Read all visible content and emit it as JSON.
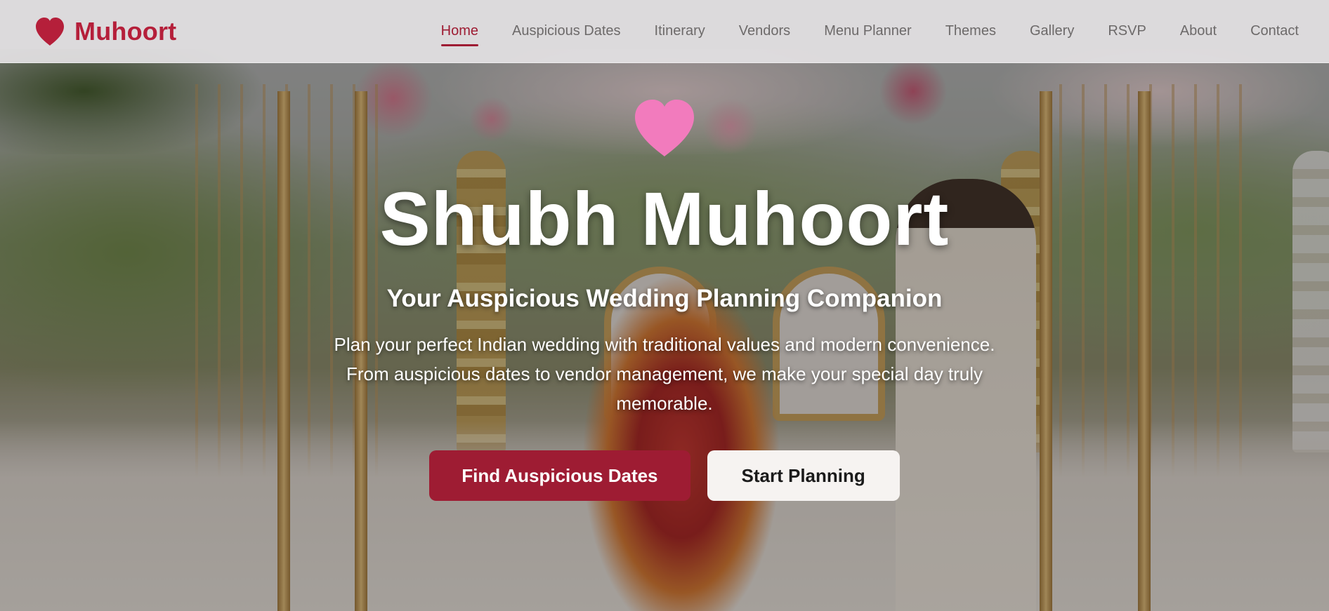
{
  "colors": {
    "brand": "#b51f3a",
    "primary_button": "#9e1c33",
    "hero_heart": "#f27bbd",
    "nav_text": "#6d6a6a"
  },
  "brand": {
    "icon": "heart-icon",
    "name": "Muhoort"
  },
  "nav": {
    "items": [
      {
        "label": "Home",
        "active": true
      },
      {
        "label": "Auspicious Dates",
        "active": false
      },
      {
        "label": "Itinerary",
        "active": false
      },
      {
        "label": "Vendors",
        "active": false
      },
      {
        "label": "Menu Planner",
        "active": false
      },
      {
        "label": "Themes",
        "active": false
      },
      {
        "label": "Gallery",
        "active": false
      },
      {
        "label": "RSVP",
        "active": false
      },
      {
        "label": "About",
        "active": false
      },
      {
        "label": "Contact",
        "active": false
      }
    ]
  },
  "hero": {
    "icon": "heart-icon",
    "title": "Shubh Muhoort",
    "subtitle": "Your Auspicious Wedding Planning Companion",
    "description": "Plan your perfect Indian wedding with traditional values and modern convenience. From auspicious dates to vendor management, we make your special day truly memorable.",
    "primary_cta": "Find Auspicious Dates",
    "secondary_cta": "Start Planning"
  }
}
